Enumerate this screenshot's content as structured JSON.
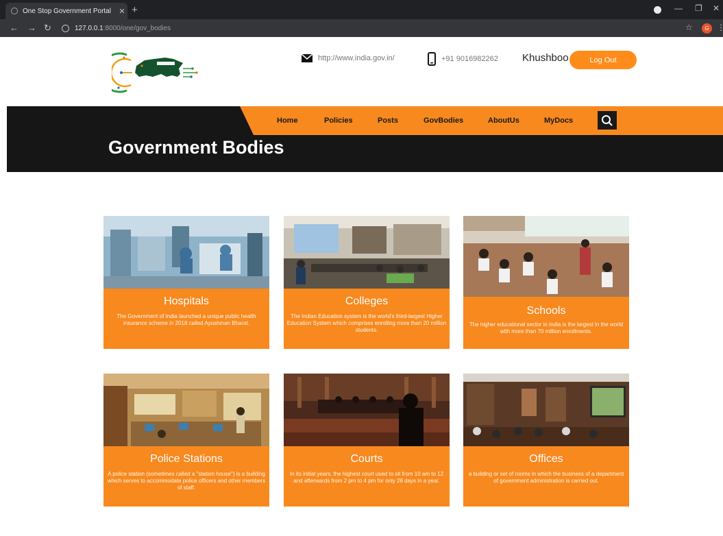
{
  "browser": {
    "tab_title": "One Stop Government Portal",
    "tab_close": "✕",
    "new_tab": "+",
    "url_host": "127.0.0.1",
    "url_path": ":8000/one/gov_bodies",
    "profile_initial": "G"
  },
  "header": {
    "website": "http://www.india.gov.in/",
    "phone": "+91 9016982262",
    "username": "Khushboo",
    "logout_label": "Log Out"
  },
  "nav": {
    "items": [
      {
        "label": "Home"
      },
      {
        "label": "Policies"
      },
      {
        "label": "Posts"
      },
      {
        "label": "GovBodies"
      },
      {
        "label": "AboutUs"
      },
      {
        "label": "MyDocs"
      }
    ]
  },
  "page": {
    "title": "Government Bodies"
  },
  "cards": [
    {
      "title": "Hospitals",
      "description": "The Government of India launched a unique public health insurance scheme in 2018 called Ayushman Bharat."
    },
    {
      "title": "Colleges",
      "description": "The Indian Education system is the world's third-largest Higher Education System which comprises enrolling more than 20 million students."
    },
    {
      "title": "Schools",
      "description": "The higher educational sector in India is the largest in the world with more than 70 million enrollments."
    },
    {
      "title": "Police Stations",
      "description": "A police station (sometimes called a \"station house\") is a building which serves to accommodate police officers and other members of staff."
    },
    {
      "title": "Courts",
      "description": "In its initial years, the highest court used to sit from 10 am to 12 and afterwards from 2 pm to 4 pm for only 28 days in a year."
    },
    {
      "title": "Offices",
      "description": "a building or set of rooms in which the business of a department of government administration is carried out."
    }
  ],
  "colors": {
    "accent": "#f7891f",
    "banner": "#161616"
  }
}
